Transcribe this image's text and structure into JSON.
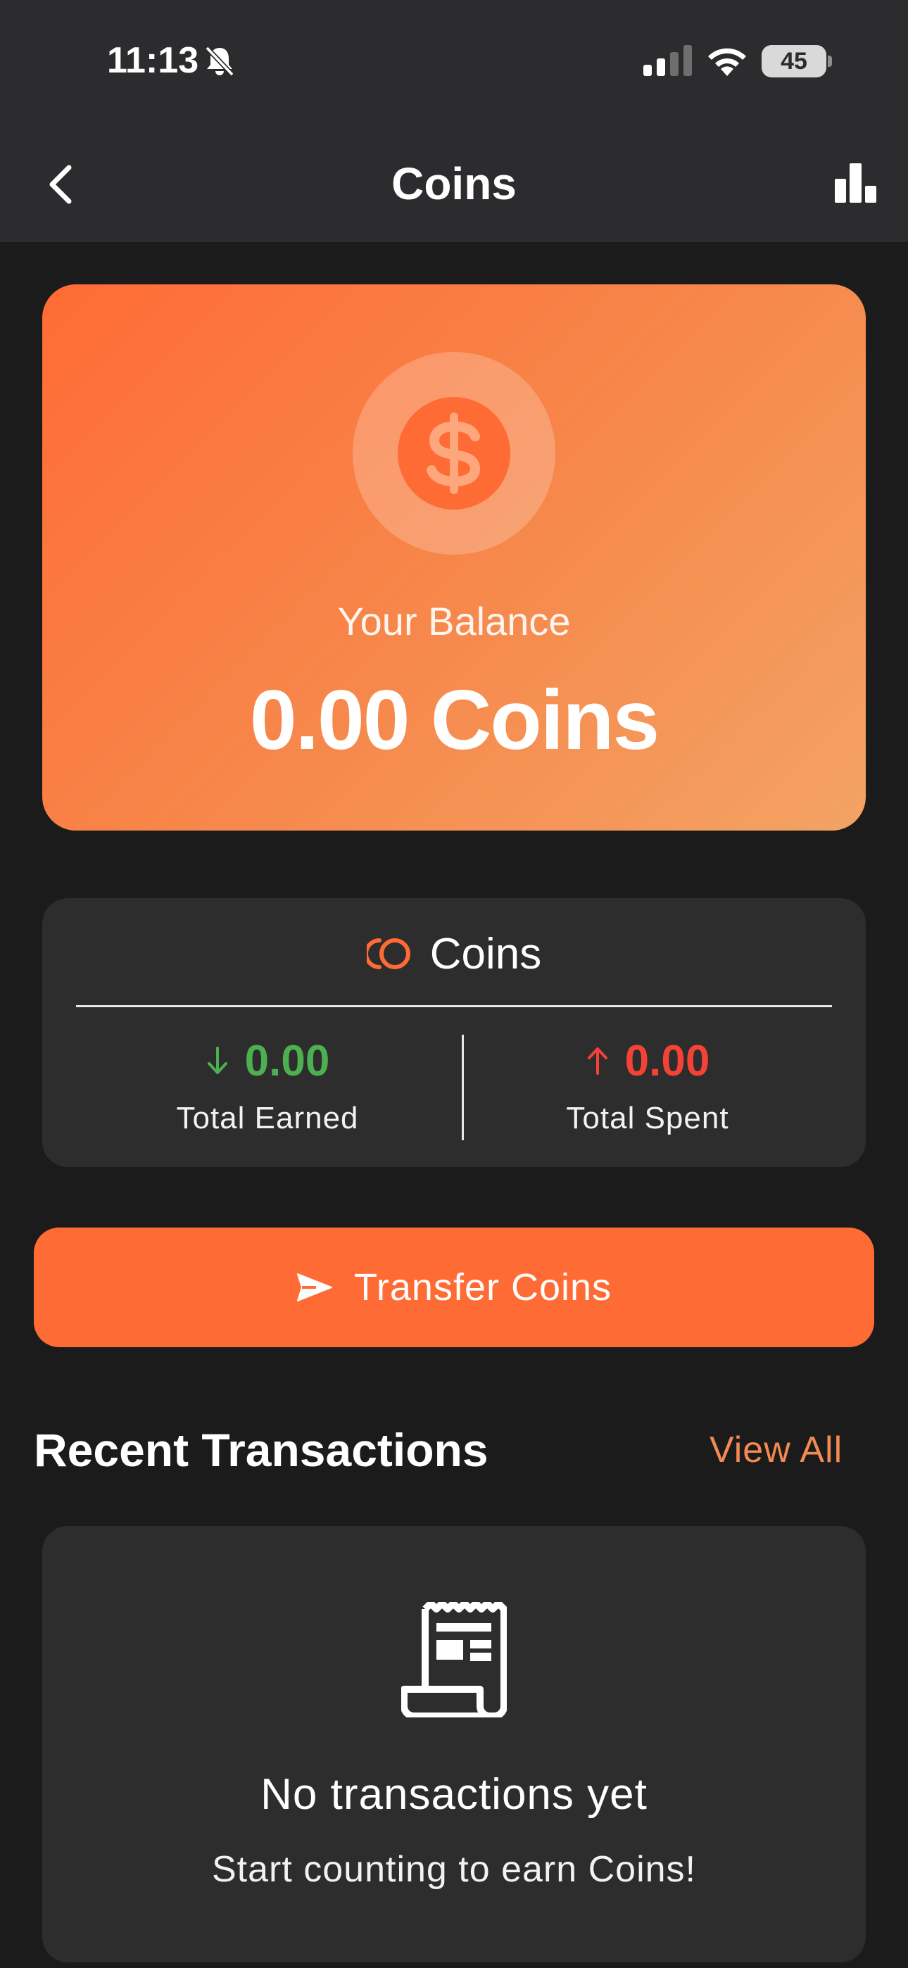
{
  "status_bar": {
    "time": "11:13",
    "battery": "45",
    "icons": [
      "bell-slash-icon",
      "signal-icon",
      "wifi-icon",
      "battery-icon"
    ]
  },
  "nav": {
    "title": "Coins",
    "back_icon": "chevron-left-icon",
    "stats_icon": "bar-chart-icon"
  },
  "balance": {
    "label": "Your Balance",
    "value": "0.00 Coins",
    "icon": "dollar-coin-icon"
  },
  "summary": {
    "title": "Coins",
    "icon": "coins-icon",
    "earned": {
      "value": "0.00",
      "label": "Total Earned",
      "icon": "arrow-down-icon",
      "color": "#4caf50"
    },
    "spent": {
      "value": "0.00",
      "label": "Total Spent",
      "icon": "arrow-up-icon",
      "color": "#f44336"
    }
  },
  "transfer": {
    "label": "Transfer Coins",
    "icon": "send-icon"
  },
  "transactions": {
    "title": "Recent Transactions",
    "view_all": "View All",
    "empty_title": "No transactions yet",
    "empty_subtitle": "Start counting to earn Coins!",
    "empty_icon": "receipt-icon"
  },
  "colors": {
    "accent": "#ff6b35",
    "background": "#1b1b1b",
    "card": "#2d2d2d",
    "header": "#2c2c2e"
  }
}
